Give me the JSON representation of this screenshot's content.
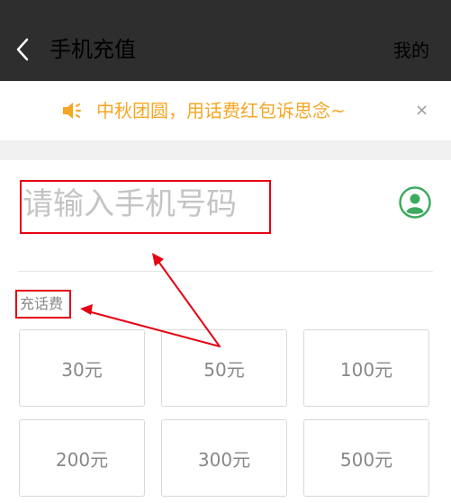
{
  "header": {
    "title": "手机充值",
    "right_link": "我的",
    "background": "#2e2e2e"
  },
  "notice": {
    "text": "中秋团圆，用话费红包诉思念~",
    "close_symbol": "×",
    "icon": "speaker-icon",
    "color": "#f5a623"
  },
  "phone": {
    "placeholder": "请输入手机号码",
    "contact_icon": "contact-person-icon",
    "icon_color": "#3daa5f"
  },
  "section": {
    "label": "充话费"
  },
  "amounts": [
    {
      "label": "30元"
    },
    {
      "label": "50元"
    },
    {
      "label": "100元"
    },
    {
      "label": "200元"
    },
    {
      "label": "300元"
    },
    {
      "label": "500元"
    }
  ],
  "annotation_color": "#e60012"
}
